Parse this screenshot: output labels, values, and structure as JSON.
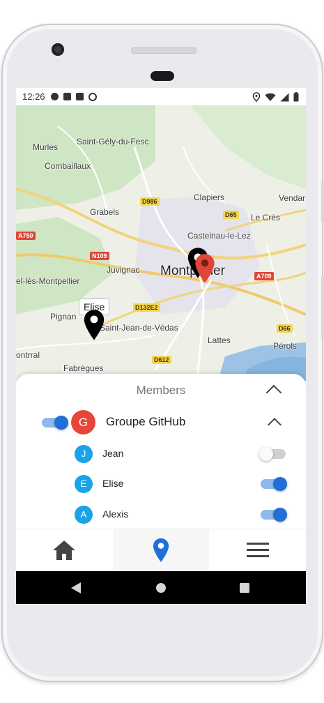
{
  "status_bar": {
    "time": "12:26"
  },
  "map": {
    "labels": [
      "Murles",
      "Saint-Gély-du-Fesc",
      "Combaillaux",
      "Clapiers",
      "Vendar",
      "Grabels",
      "Le Crès",
      "Castelnau-le-Lez",
      "Juvignac",
      "Montpellier",
      "el-lès-Montpellier",
      "Pignan",
      "Saint-Jean-de-Védas",
      "Lattes",
      "Pérols",
      "ontrral",
      "Fabrègues"
    ],
    "road_badges": [
      "D986",
      "D65",
      "A750",
      "N109",
      "A709",
      "D132E2",
      "D66",
      "D612"
    ],
    "tooltip": "Elise",
    "marker_colors": {
      "black": "#000000",
      "red": "#e0453a"
    }
  },
  "sheet": {
    "title": "Members",
    "group": {
      "avatar_letter": "G",
      "avatar_color": "#e8453a",
      "name": "Groupe GitHub",
      "enabled": true
    },
    "members": [
      {
        "letter": "J",
        "name": "Jean",
        "enabled": false
      },
      {
        "letter": "E",
        "name": "Elise",
        "enabled": true
      },
      {
        "letter": "A",
        "name": "Alexis",
        "enabled": true
      }
    ],
    "member_avatar_color": "#1aa3e8"
  },
  "bottom_nav": {
    "items": [
      "home-icon",
      "location-pin-icon",
      "menu-icon"
    ],
    "active_index": 1,
    "accent_color": "#1f6fd6"
  },
  "system_nav": [
    "back-icon",
    "home-circle-icon",
    "recents-icon"
  ]
}
